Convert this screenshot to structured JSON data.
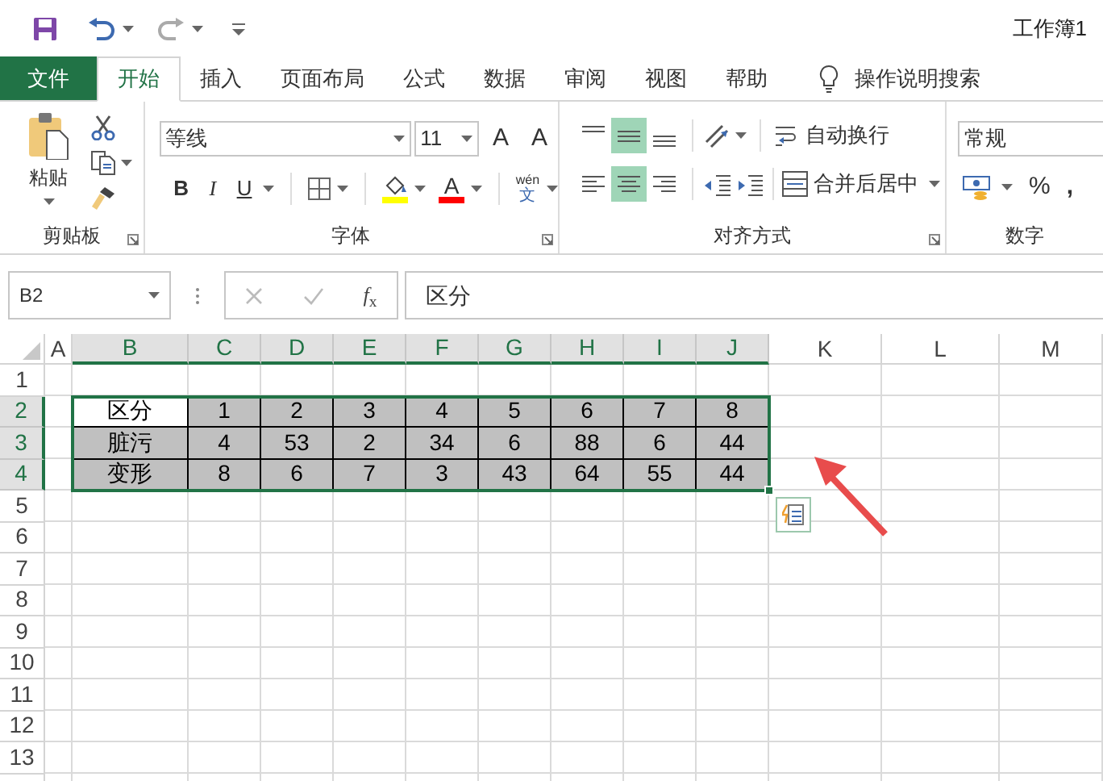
{
  "title_bar": {
    "title": "工作簿1"
  },
  "tabs": [
    {
      "label": "文件",
      "kind": "file",
      "selected": false
    },
    {
      "label": "开始",
      "kind": "tab",
      "selected": true
    },
    {
      "label": "插入",
      "kind": "tab",
      "selected": false
    },
    {
      "label": "页面布局",
      "kind": "tab",
      "selected": false
    },
    {
      "label": "公式",
      "kind": "tab",
      "selected": false
    },
    {
      "label": "数据",
      "kind": "tab",
      "selected": false
    },
    {
      "label": "审阅",
      "kind": "tab",
      "selected": false
    },
    {
      "label": "视图",
      "kind": "tab",
      "selected": false
    },
    {
      "label": "帮助",
      "kind": "tab",
      "selected": false
    }
  ],
  "tell_me": {
    "label": "操作说明搜索"
  },
  "ribbon": {
    "clipboard": {
      "label": "剪贴板",
      "paste": "粘贴"
    },
    "font": {
      "label": "字体",
      "font_name": "等线",
      "font_size": "11",
      "grow": "A",
      "shrink": "A",
      "bold": "B",
      "italic": "I",
      "underline": "U",
      "font_color": "A",
      "phonetic_top": "wén",
      "phonetic_bottom": "文"
    },
    "alignment": {
      "label": "对齐方式",
      "vertical": [
        {
          "selected": false
        },
        {
          "selected": true
        },
        {
          "selected": false
        }
      ],
      "horizontal": [
        {
          "selected": false
        },
        {
          "selected": true
        },
        {
          "selected": false
        }
      ],
      "wrap_text": "自动换行",
      "merge_center": "合并后居中"
    },
    "number": {
      "label": "数字",
      "format": "常规",
      "percent": "%",
      "comma": ","
    }
  },
  "formula_bar": {
    "name_box": "B2",
    "insert_function": "*f*$_{x}$",
    "formula": "区分"
  },
  "sheet": {
    "columns": [
      {
        "label": "A",
        "selected": false
      },
      {
        "label": "B",
        "selected": true
      },
      {
        "label": "C",
        "selected": true
      },
      {
        "label": "D",
        "selected": true
      },
      {
        "label": "E",
        "selected": true
      },
      {
        "label": "F",
        "selected": true
      },
      {
        "label": "G",
        "selected": true
      },
      {
        "label": "H",
        "selected": true
      },
      {
        "label": "I",
        "selected": true
      },
      {
        "label": "J",
        "selected": true
      },
      {
        "label": "K",
        "selected": false
      },
      {
        "label": "L",
        "selected": false
      },
      {
        "label": "M",
        "selected": false
      }
    ],
    "rows": [
      {
        "label": "1",
        "selected": false
      },
      {
        "label": "2",
        "selected": true,
        "cells": [
          {
            "text": "区分",
            "shaded": false
          },
          {
            "text": "1",
            "shaded": true
          },
          {
            "text": "2",
            "shaded": true
          },
          {
            "text": "3",
            "shaded": true
          },
          {
            "text": "4",
            "shaded": true
          },
          {
            "text": "5",
            "shaded": true
          },
          {
            "text": "6",
            "shaded": true
          },
          {
            "text": "7",
            "shaded": true
          },
          {
            "text": "8",
            "shaded": true
          }
        ]
      },
      {
        "label": "3",
        "selected": true,
        "cells": [
          {
            "text": "脏污",
            "shaded": true
          },
          {
            "text": "4",
            "shaded": true
          },
          {
            "text": "53",
            "shaded": true
          },
          {
            "text": "2",
            "shaded": true
          },
          {
            "text": "34",
            "shaded": true
          },
          {
            "text": "6",
            "shaded": true
          },
          {
            "text": "88",
            "shaded": true
          },
          {
            "text": "6",
            "shaded": true
          },
          {
            "text": "44",
            "shaded": true
          }
        ]
      },
      {
        "label": "4",
        "selected": true,
        "cells": [
          {
            "text": "变形",
            "shaded": true
          },
          {
            "text": "8",
            "shaded": true
          },
          {
            "text": "6",
            "shaded": true
          },
          {
            "text": "7",
            "shaded": true
          },
          {
            "text": "3",
            "shaded": true
          },
          {
            "text": "43",
            "shaded": true
          },
          {
            "text": "64",
            "shaded": true
          },
          {
            "text": "55",
            "shaded": true
          },
          {
            "text": "44",
            "shaded": true
          }
        ]
      },
      {
        "label": "5",
        "selected": false
      },
      {
        "label": "6",
        "selected": false
      },
      {
        "label": "7",
        "selected": false
      },
      {
        "label": "8",
        "selected": false
      },
      {
        "label": "9",
        "selected": false
      },
      {
        "label": "10",
        "selected": false
      },
      {
        "label": "11",
        "selected": false
      },
      {
        "label": "12",
        "selected": false
      },
      {
        "label": "13",
        "selected": false
      }
    ]
  }
}
